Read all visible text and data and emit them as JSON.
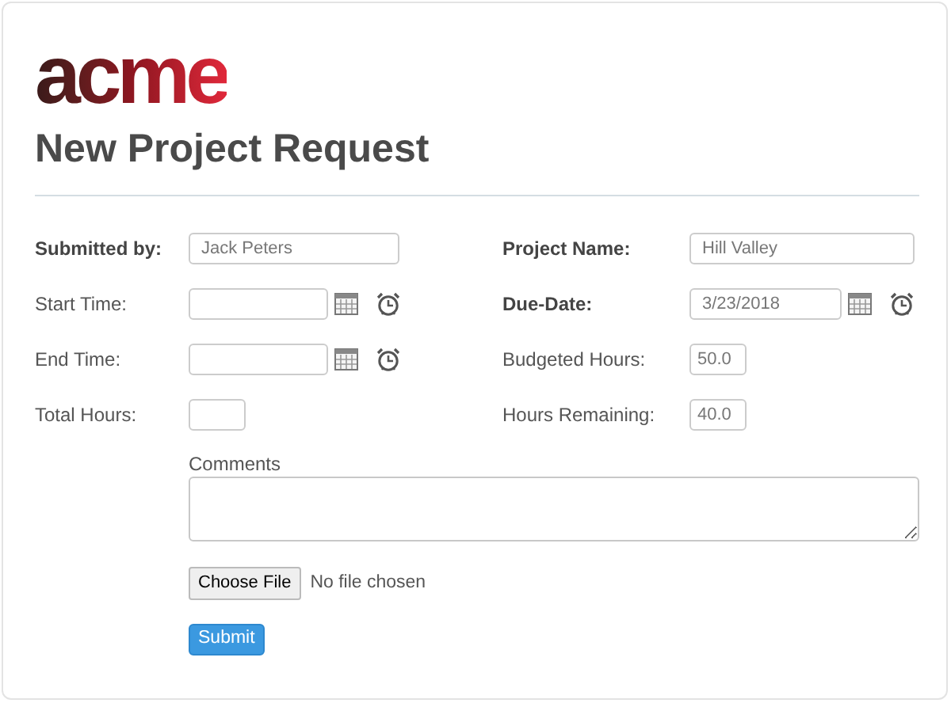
{
  "logo": "acme",
  "title": "New Project Request",
  "left_fields": [
    {
      "label": "Submitted by:",
      "required": true,
      "kind": "text",
      "value": "Jack Peters"
    },
    {
      "label": "Start Time:",
      "required": false,
      "kind": "datetime"
    },
    {
      "label": "End Time:",
      "required": false,
      "kind": "datetime"
    },
    {
      "label": "Total Hours:",
      "required": false,
      "kind": "number"
    }
  ],
  "right_fields": [
    {
      "label": "Project Name:",
      "required": true,
      "kind": "text",
      "value": "Hill Valley"
    },
    {
      "label": "Due-Date:",
      "required": true,
      "kind": "datetime",
      "value": "3/23/2018"
    },
    {
      "label": "Budgeted Hours:",
      "required": false,
      "kind": "number",
      "value": "50.0"
    },
    {
      "label": "Hours Remaining:",
      "required": false,
      "kind": "number",
      "value": "40.0"
    }
  ],
  "comments": {
    "label": "Comments"
  },
  "file": {
    "button": "Choose File",
    "status": "No file chosen"
  },
  "submit": "Submit"
}
